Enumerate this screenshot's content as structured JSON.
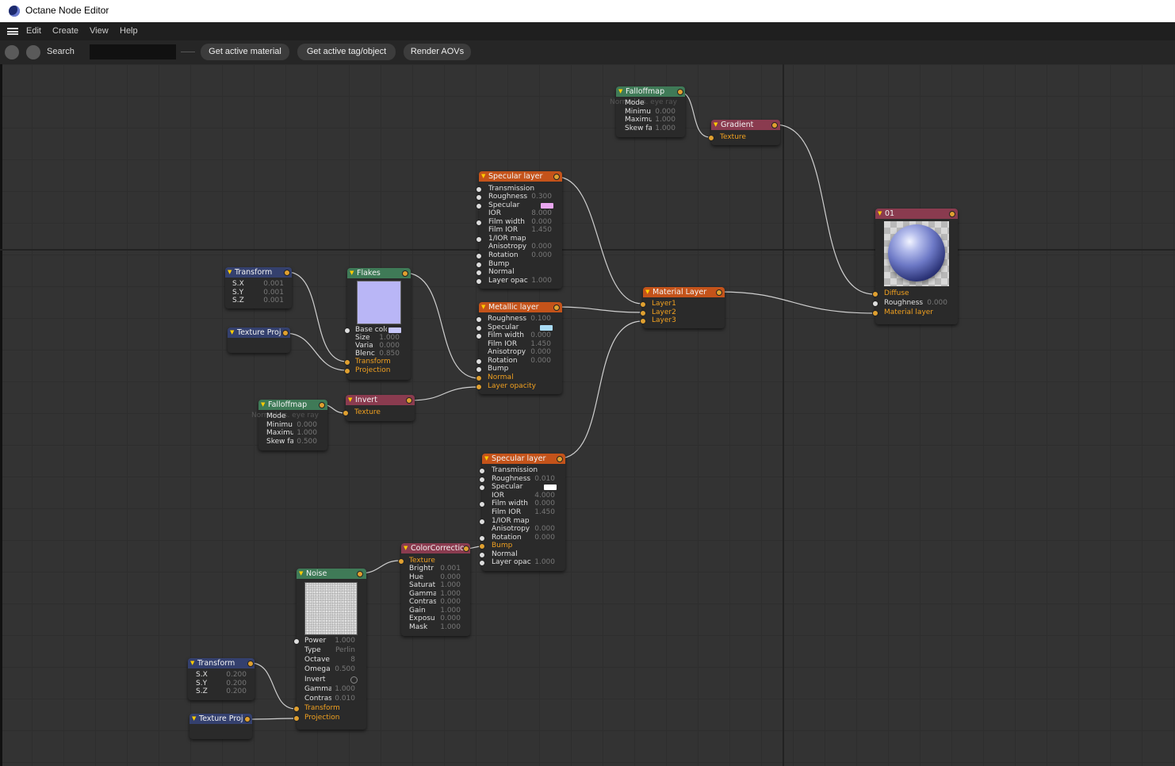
{
  "window": {
    "title": "Octane Node Editor"
  },
  "menu": [
    "Edit",
    "Create",
    "View",
    "Help"
  ],
  "toolbar": {
    "search_label": "Search",
    "search_value": "",
    "buttons": [
      "Get active material",
      "Get active tag/object",
      "Render AOVs"
    ]
  },
  "nodes": {
    "falloff_top": {
      "title": "Falloffmap",
      "ghost": "Normal vs. eye ray",
      "rows": [
        {
          "label": "Mode",
          "value": ""
        },
        {
          "label": "Minimu",
          "value": "0.000"
        },
        {
          "label": "Maximu",
          "value": "1.000"
        },
        {
          "label": "Skew fa",
          "value": "1.000"
        }
      ]
    },
    "gradient": {
      "title": "Gradient",
      "rows": [
        {
          "label": "Texture"
        }
      ]
    },
    "spec1": {
      "title": "Specular layer",
      "rows": [
        {
          "label": "Transmission",
          "value": ""
        },
        {
          "label": "Roughness",
          "value": "0.300"
        },
        {
          "label": "Specular",
          "value": "",
          "swatch": "#e9a6f0"
        },
        {
          "label": "IOR",
          "value": "8.000"
        },
        {
          "label": "Film width",
          "value": "0.000"
        },
        {
          "label": "Film IOR",
          "value": "1.450"
        },
        {
          "label": "1/IOR map",
          "value": ""
        },
        {
          "label": "Anisotropy",
          "value": "0.000"
        },
        {
          "label": "Rotation",
          "value": "0.000"
        },
        {
          "label": "Bump",
          "value": ""
        },
        {
          "label": "Normal",
          "value": ""
        },
        {
          "label": "Layer opac",
          "value": "1.000"
        }
      ]
    },
    "transform1": {
      "title": "Transform",
      "rows": [
        {
          "label": "S.X",
          "value": "0.001"
        },
        {
          "label": "S.Y",
          "value": "0.001"
        },
        {
          "label": "S.Z",
          "value": "0.001"
        }
      ]
    },
    "texproj1": {
      "title": "Texture Proj"
    },
    "flakes": {
      "title": "Flakes",
      "preview_color": "#b9b6f6",
      "rows": [
        {
          "label": "Base colo",
          "value": "",
          "swatch": "#c6c6fa"
        },
        {
          "label": "Size",
          "value": "1.000"
        },
        {
          "label": "Varia",
          "value": "0.000"
        },
        {
          "label": "Blenc",
          "value": "0.850"
        },
        {
          "label": "Transform"
        },
        {
          "label": "Projection"
        }
      ]
    },
    "metallic": {
      "title": "Metallic layer",
      "rows": [
        {
          "label": "Roughness",
          "value": "0.100"
        },
        {
          "label": "Specular",
          "value": "",
          "swatch": "#a9dcf6"
        },
        {
          "label": "Film width",
          "value": "0.000"
        },
        {
          "label": "Film IOR",
          "value": "1.450"
        },
        {
          "label": "Anisotropy",
          "value": "0.000"
        },
        {
          "label": "Rotation",
          "value": "0.000"
        },
        {
          "label": "Bump",
          "value": ""
        },
        {
          "label": "Normal"
        },
        {
          "label": "Layer opacity"
        }
      ]
    },
    "matlayer": {
      "title": "Material Layer",
      "rows": [
        {
          "label": "Layer1"
        },
        {
          "label": "Layer2"
        },
        {
          "label": "Layer3"
        }
      ]
    },
    "output": {
      "title": "01",
      "rows": [
        {
          "label": "Diffuse"
        },
        {
          "label": "Roughness",
          "value": "0.000"
        },
        {
          "label": "Material layer"
        }
      ]
    },
    "falloff2": {
      "title": "Falloffmap",
      "ghost": "Normal vs. eye ray",
      "rows": [
        {
          "label": "Mode",
          "value": ""
        },
        {
          "label": "Minimu",
          "value": "0.000"
        },
        {
          "label": "Maximu",
          "value": "1.000"
        },
        {
          "label": "Skew fa",
          "value": "0.500"
        }
      ]
    },
    "invert": {
      "title": "Invert",
      "rows": [
        {
          "label": "Texture"
        }
      ]
    },
    "spec2": {
      "title": "Specular layer",
      "rows": [
        {
          "label": "Transmission",
          "value": ""
        },
        {
          "label": "Roughness",
          "value": "0.010"
        },
        {
          "label": "Specular",
          "value": "",
          "swatch": "#ffffff"
        },
        {
          "label": "IOR",
          "value": "4.000"
        },
        {
          "label": "Film width",
          "value": "0.000"
        },
        {
          "label": "Film IOR",
          "value": "1.450"
        },
        {
          "label": "1/IOR map",
          "value": ""
        },
        {
          "label": "Anisotropy",
          "value": "0.000"
        },
        {
          "label": "Rotation",
          "value": "0.000"
        },
        {
          "label": "Bump"
        },
        {
          "label": "Normal",
          "value": ""
        },
        {
          "label": "Layer opac",
          "value": "1.000"
        }
      ]
    },
    "colorcorr": {
      "title": "ColorCorrection",
      "rows": [
        {
          "label": "Texture"
        },
        {
          "label": "Brightr",
          "value": "0.001"
        },
        {
          "label": "Hue",
          "value": "0.000"
        },
        {
          "label": "Saturat",
          "value": "1.000"
        },
        {
          "label": "Gamma",
          "value": "1.000"
        },
        {
          "label": "Contras",
          "value": "0.000"
        },
        {
          "label": "Gain",
          "value": "1.000"
        },
        {
          "label": "Exposu",
          "value": "0.000"
        },
        {
          "label": "Mask",
          "value": "1.000"
        }
      ]
    },
    "noise": {
      "title": "Noise",
      "rows": [
        {
          "label": "Power",
          "value": "1.000"
        },
        {
          "label": "Type",
          "value": "Perlin"
        },
        {
          "label": "Octave",
          "value": "8"
        },
        {
          "label": "Omega",
          "value": "0.500"
        },
        {
          "label": "Invert",
          "value": ""
        },
        {
          "label": "Gamma",
          "value": "1.000"
        },
        {
          "label": "Contras",
          "value": "0.010"
        },
        {
          "label": "Transform"
        },
        {
          "label": "Projection"
        }
      ]
    },
    "transform2": {
      "title": "Transform",
      "rows": [
        {
          "label": "S.X",
          "value": "0.200"
        },
        {
          "label": "S.Y",
          "value": "0.200"
        },
        {
          "label": "S.Z",
          "value": "0.200"
        }
      ]
    },
    "texproj2": {
      "title": "Texture Proj"
    }
  }
}
